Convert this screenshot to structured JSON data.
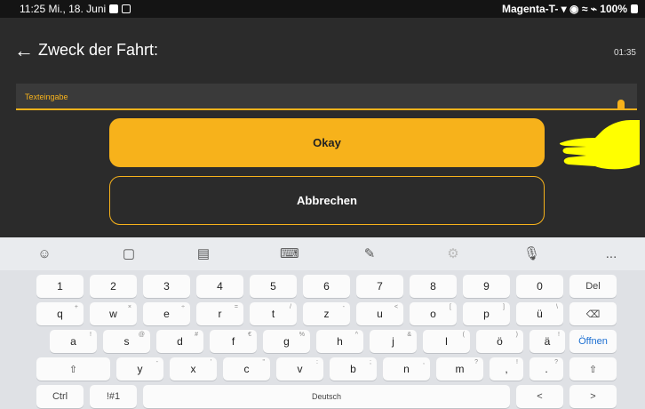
{
  "status_bar": {
    "time_date": "11:25 Mi., 18. Juni",
    "carrier_battery": "Magenta-T- ▾ ◉ ≈ ⌁ 100%"
  },
  "header": {
    "title": "Zweck der Fahrt:",
    "timer": "01:35"
  },
  "text_field": {
    "label": "Texteingabe"
  },
  "buttons": {
    "okay": "Okay",
    "cancel": "Abbrechen"
  },
  "keyboard": {
    "toolbar_more": "...",
    "row1": [
      "1",
      "2",
      "3",
      "4",
      "5",
      "6",
      "7",
      "8",
      "9",
      "0",
      "Del"
    ],
    "row2": [
      {
        "k": "q",
        "h": "+"
      },
      {
        "k": "w",
        "h": "×"
      },
      {
        "k": "e",
        "h": "÷"
      },
      {
        "k": "r",
        "h": "="
      },
      {
        "k": "t",
        "h": "/"
      },
      {
        "k": "z",
        "h": "-"
      },
      {
        "k": "u",
        "h": "<"
      },
      {
        "k": "i",
        "h": ">"
      },
      {
        "k": "o",
        "h": "["
      },
      {
        "k": "p",
        "h": "]"
      },
      {
        "k": "ü",
        "h": "\\"
      }
    ],
    "row3": [
      {
        "k": "a",
        "h": "!"
      },
      {
        "k": "s",
        "h": "@"
      },
      {
        "k": "d",
        "h": "#"
      },
      {
        "k": "f",
        "h": "€"
      },
      {
        "k": "g",
        "h": "%"
      },
      {
        "k": "h",
        "h": "^"
      },
      {
        "k": "j",
        "h": "&"
      },
      {
        "k": "k",
        "h": "*"
      },
      {
        "k": "l",
        "h": "("
      },
      {
        "k": "ö",
        "h": ")"
      },
      {
        "k": "ä",
        "h": "!"
      }
    ],
    "enter_label": "Öffnen",
    "row4": [
      {
        "k": "y",
        "h": "-"
      },
      {
        "k": "x",
        "h": "'"
      },
      {
        "k": "c",
        "h": "\""
      },
      {
        "k": "v",
        "h": ":"
      },
      {
        "k": "b",
        "h": ";"
      },
      {
        "k": "n",
        "h": ","
      },
      {
        "k": "m",
        "h": "?"
      },
      {
        "k": ",",
        "h": "!"
      },
      {
        "k": ".",
        "h": "?"
      }
    ],
    "ctrl_label": "Ctrl",
    "symbols_label": "!#1",
    "space_label": "Deutsch",
    "left_label": "<",
    "right_label": ">"
  },
  "colors": {
    "accent": "#f7b21b",
    "background": "#2b2b2b"
  }
}
